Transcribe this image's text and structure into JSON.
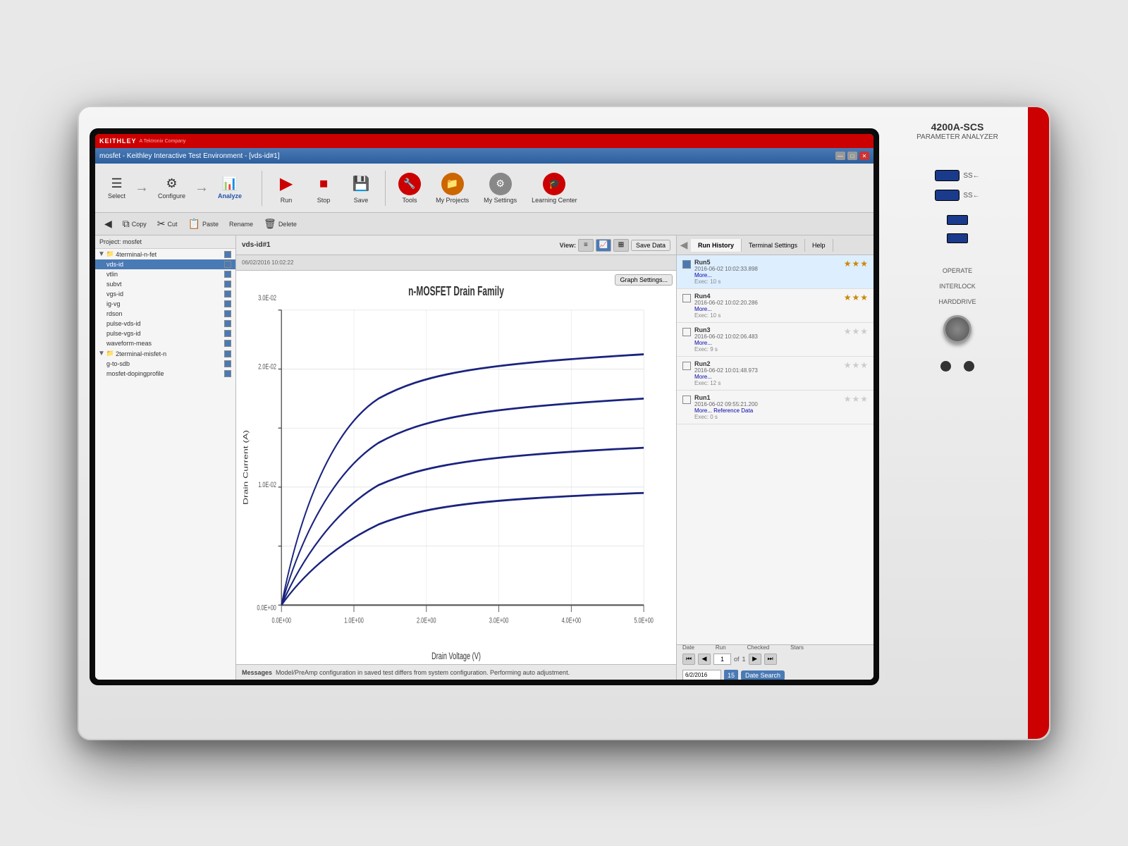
{
  "instrument": {
    "model": "4200A-SCS",
    "name": "PARAMETER ANALYZER"
  },
  "titleBar": {
    "text": "mosfet - Keithley Interactive Test Environment - [vds-id#1]",
    "minBtn": "—",
    "maxBtn": "□",
    "closeBtn": "✕"
  },
  "toolbar": {
    "run_label": "Run",
    "stop_label": "Stop",
    "save_label": "Save",
    "tools_label": "Tools",
    "my_projects_label": "My Projects",
    "my_settings_label": "My Settings",
    "learning_center_label": "Learning Center"
  },
  "workflow": {
    "select_label": "Select",
    "configure_label": "Configure",
    "analyze_label": "Analyze"
  },
  "secondary_toolbar": {
    "copy_label": "Copy",
    "cut_label": "Cut",
    "paste_label": "Paste",
    "rename_label": "Rename",
    "delete_label": "Delete"
  },
  "project": {
    "name": "mosfet",
    "tree": [
      {
        "label": "4terminal-n-fet",
        "indent": 0,
        "type": "folder",
        "checked": true
      },
      {
        "label": "vds-id",
        "indent": 1,
        "checked": true,
        "active": true
      },
      {
        "label": "vtlin",
        "indent": 1,
        "checked": true
      },
      {
        "label": "subvt",
        "indent": 1,
        "checked": true
      },
      {
        "label": "vgs-id",
        "indent": 1,
        "checked": true
      },
      {
        "label": "ig-vg",
        "indent": 1,
        "checked": true
      },
      {
        "label": "rdson",
        "indent": 1,
        "checked": true
      },
      {
        "label": "pulse-vds-id",
        "indent": 1,
        "checked": true
      },
      {
        "label": "pulse-vgs-id",
        "indent": 1,
        "checked": true
      },
      {
        "label": "waveform-meas",
        "indent": 1,
        "checked": true
      },
      {
        "label": "2terminal-misfet-n",
        "indent": 0,
        "type": "folder",
        "checked": true
      },
      {
        "label": "g-to-sdb",
        "indent": 1,
        "checked": true
      },
      {
        "label": "mosfet-dopingprofile",
        "indent": 1,
        "checked": true
      }
    ]
  },
  "chart": {
    "title": "vds-id#1",
    "date": "06/02/2016 10:02:22",
    "graph_title": "n-MOSFET Drain Family",
    "x_label": "Drain Voltage (V)",
    "y_label": "Drain Current (A)",
    "x_ticks": [
      "0.0E+00",
      "1.0E+00",
      "2.0E+00",
      "3.0E+00",
      "4.0E+00",
      "5.0E+00"
    ],
    "y_ticks": [
      "0.0E+00",
      "1.0E-02",
      "2.0E-02",
      "3.0E-02"
    ],
    "save_data_label": "Save Data",
    "graph_settings_label": "Graph Settings..."
  },
  "messages": {
    "label": "Messages",
    "text": "Model/PreAmp configuration in saved test differs from system configuration. Performing auto adjustment."
  },
  "runHistory": {
    "tab_label": "Run History",
    "terminal_settings_label": "Terminal Settings",
    "help_label": "Help",
    "columns": {
      "date": "Date",
      "run": "Run",
      "checked": "Checked",
      "stars": "Stars"
    },
    "runs": [
      {
        "id": "Run5",
        "date": "2016-06-02 10:02:33.898",
        "more": "More...",
        "exec": "Exec: 10 s",
        "checked": true,
        "stars": [
          true,
          true,
          true
        ]
      },
      {
        "id": "Run4",
        "date": "2016-06-02 10:02:20.286",
        "more": "More...",
        "exec": "Exec: 10 s",
        "checked": false,
        "stars": [
          true,
          true,
          true
        ]
      },
      {
        "id": "Run3",
        "date": "2016-06-02 10:02:06.483",
        "more": "More...",
        "exec": "Exec: 9 s",
        "checked": false,
        "stars": [
          false,
          false,
          false
        ]
      },
      {
        "id": "Run2",
        "date": "2016-06-02 10:01:48.973",
        "more": "More...",
        "exec": "Exec: 12 s",
        "checked": false,
        "stars": [
          false,
          false,
          false
        ]
      },
      {
        "id": "Run1",
        "date": "2016-06-02 09:55:21.200",
        "more": "More...  Reference Data",
        "exec": "Exec: 0 s",
        "checked": false,
        "stars": [
          false,
          false,
          false
        ]
      }
    ],
    "pagination": {
      "page": "1",
      "of": "of",
      "total": "1",
      "date_value": "6/2/2016",
      "date_num": "15",
      "date_search_label": "Date Search"
    }
  },
  "status": {
    "operate": "OPERATE",
    "interlock": "INTERLOCK",
    "harddrive": "HARDDRIVE"
  }
}
